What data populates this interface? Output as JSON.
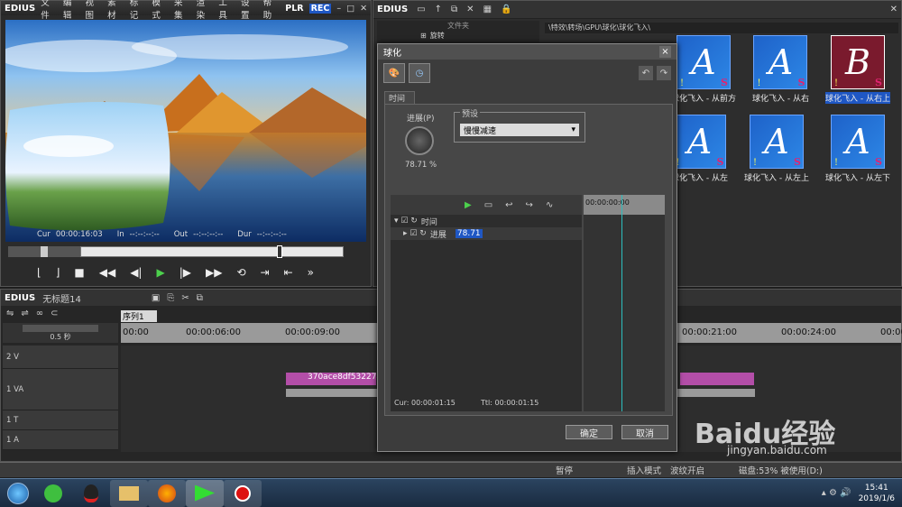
{
  "player": {
    "app_logo": "EDIUS",
    "menu": [
      "文件",
      "编辑",
      "视图",
      "素材",
      "标记",
      "模式",
      "采集",
      "渲染",
      "工具",
      "设置",
      "帮助"
    ],
    "mode_plr": "PLR",
    "mode_rec": "REC",
    "cur_label": "Cur",
    "cur_value": "00:00:16:03",
    "in_label": "In",
    "in_value": "--:--:--:--",
    "out_label": "Out",
    "out_value": "--:--:--:--",
    "dur_label": "Dur",
    "dur_value": "--:--:--:--",
    "scrub_position": 0.76
  },
  "bin": {
    "app_logo": "EDIUS",
    "folder_header": "文件夹",
    "tree_item": "旋转",
    "path": "\\特效\\转场\\GPU\\球化\\球化飞入\\",
    "thumbs": [
      {
        "letter": "A",
        "caption": "球化飞入 - 从前方",
        "selected": false
      },
      {
        "letter": "A",
        "caption": "球化飞入 - 从右",
        "selected": false
      },
      {
        "letter": "B",
        "caption": "球化飞入 - 从右上",
        "selected": true
      },
      {
        "letter": "A",
        "caption": "球化飞入 - 从左",
        "selected": false
      },
      {
        "letter": "A",
        "caption": "球化飞入 - 从左上",
        "selected": false
      },
      {
        "letter": "A",
        "caption": "球化飞入 - 从左下",
        "selected": false
      }
    ]
  },
  "dialog": {
    "title": "球化",
    "close": "×",
    "tab_time": "时间",
    "progress_label": "进展(P)",
    "progress_value": "78.71 %",
    "preset_label": "预设",
    "preset_value": "慢慢减速",
    "tree_time": "时间",
    "tree_progress": "进展",
    "tree_progress_value": "78.71",
    "ruler_time": "00:00:00:00",
    "cur": "Cur: 00:00:01:15",
    "ttl": "Ttl: 00:00:01:15",
    "ok": "确定",
    "cancel": "取消"
  },
  "timeline": {
    "app_logo": "EDIUS",
    "project": "无标题14",
    "sequence_tab": "序列1",
    "zoom": "0.5 秒",
    "ruler": [
      "00:00",
      "00:00:06:00",
      "00:00:09:00",
      "00:00:21:00",
      "00:00:24:00",
      "00:00"
    ],
    "tracks": [
      {
        "name": "2 V"
      },
      {
        "name": "1 VA"
      },
      {
        "name": "1 T"
      },
      {
        "name": "1 A"
      }
    ],
    "clip_name": "370ace8df53227a2"
  },
  "status": {
    "pause": "暂停",
    "insert_mode": "插入模式",
    "ripple": "波纹开启",
    "disk": "磁盘:53% 被使用(D:)"
  },
  "taskbar": {
    "time": "15:41",
    "date": "2019/1/6"
  },
  "watermark": {
    "brand": "Baidu经验",
    "url": "jingyan.baidu.com"
  },
  "colors": {
    "accent_blue": "#1f57c4",
    "clip_pink": "#b34ea8",
    "thumb_blue": "#2d87e6",
    "selected_thumb": "#7a1a2d",
    "play_green": "#4cd04c"
  }
}
